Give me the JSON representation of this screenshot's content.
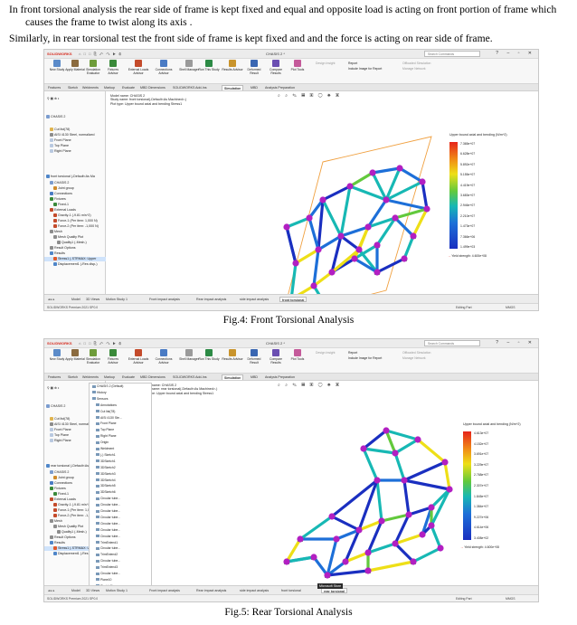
{
  "intro": {
    "line1": "In front torsional analysis the rear side of frame is kept fixed and equal and opposite load is acting on front portion of frame  which",
    "line2": "causes the frame to twist along its axis .",
    "line3": "Similarly, in rear torsional test the front side of frame is kept fixed and and the force is acting on rear side of frame."
  },
  "fig4": {
    "caption": "Fig.4: Front Torsional Analysis",
    "app": {
      "logo": "SOLIDWORKS",
      "document_title": "CHASIS 2 *",
      "search_placeholder": "Search Commands",
      "ribbon": [
        {
          "label": "New Study",
          "icon": "new-study-icon",
          "color": "#5b8bc9"
        },
        {
          "label": "Apply Material",
          "icon": "apply-material-icon",
          "color": "#8b6b3f"
        },
        {
          "label": "Simulation Evaluator",
          "icon": "simulation-evaluator-icon",
          "color": "#6e9c3a"
        },
        {
          "label": "Fixtures Advisor",
          "icon": "fixtures-advisor-icon",
          "color": "#3a8a3a"
        },
        {
          "label": "External Loads Advisor",
          "icon": "external-loads-icon",
          "color": "#c44b2b"
        },
        {
          "label": "Connections Advisor",
          "icon": "connections-advisor-icon",
          "color": "#4a7bc4"
        },
        {
          "label": "Shell Manager",
          "icon": "shell-manager-icon",
          "color": "#9a9a9a"
        },
        {
          "label": "Run This Study",
          "icon": "run-study-icon",
          "color": "#2c8a45"
        },
        {
          "label": "Results Advisor",
          "icon": "results-advisor-icon",
          "color": "#c9942c"
        },
        {
          "label": "Deformed Result",
          "icon": "deformed-result-icon",
          "color": "#3a67b2"
        },
        {
          "label": "Compare Results",
          "icon": "compare-results-icon",
          "color": "#6b4fb2"
        },
        {
          "label": "Plot Tools",
          "icon": "plot-tools-icon",
          "color": "#c45a9a"
        }
      ],
      "ribbon_right": {
        "design_insight": "Design Insight",
        "report": "Report",
        "include_image": "Include Image for Report",
        "offload": "Offloaded Simulation",
        "manage_network": "Manage Network"
      },
      "tabs": [
        "Features",
        "Sketch",
        "Weldments",
        "Markup",
        "Evaluate",
        "MBD Dimensions",
        "SOLIDWORKS Add-Ins",
        "Simulation",
        "MBD",
        "Analysis Preparation"
      ],
      "active_tab": "Simulation",
      "tree": [
        {
          "label": "CHASIS 2",
          "depth": 0,
          "color": "#7b9ccf"
        },
        {
          "label": "Cut list(78)",
          "depth": 1,
          "color": "#e0b44f"
        },
        {
          "label": "AISI 4130 Steel, normalized",
          "depth": 1,
          "color": "#8c8c8c"
        },
        {
          "label": "Front Plane",
          "depth": 1,
          "color": "#b9c9e0"
        },
        {
          "label": "Top Plane",
          "depth": 1,
          "color": "#b9c9e0"
        },
        {
          "label": "Right Plane",
          "depth": 1,
          "color": "#b9c9e0"
        },
        {
          "label": "front torsional (-Default<As Ma",
          "depth": 0,
          "color": "#4f86c9"
        },
        {
          "label": "CHASIS 2",
          "depth": 1,
          "color": "#7b9ccf"
        },
        {
          "label": "Joint group",
          "depth": 2,
          "color": "#d08b2b"
        },
        {
          "label": "Connections",
          "depth": 1,
          "color": "#4a7bc4"
        },
        {
          "label": "Fixtures",
          "depth": 1,
          "color": "#3a8a3a"
        },
        {
          "label": "Fixed-1",
          "depth": 2,
          "color": "#3a8a3a"
        },
        {
          "label": "External Loads",
          "depth": 1,
          "color": "#c44b2b"
        },
        {
          "label": "Gravity-1 (-9.81 m/s^2)",
          "depth": 2,
          "color": "#c44b2b"
        },
        {
          "label": "Force-1 (Per item: 1,000 N)",
          "depth": 2,
          "color": "#c44b2b"
        },
        {
          "label": "Force-2 (Per item: -1,000 N)",
          "depth": 2,
          "color": "#c44b2b"
        },
        {
          "label": "Mesh",
          "depth": 1,
          "color": "#8c8c8c"
        },
        {
          "label": "Mesh Quality Plot",
          "depth": 2,
          "color": "#8c8c8c"
        },
        {
          "label": "Quality1 (-Mesh-)",
          "depth": 3,
          "color": "#8c8c8c"
        },
        {
          "label": "Result Options",
          "depth": 1,
          "color": "#8c8c8c"
        },
        {
          "label": "Results",
          "depth": 1,
          "color": "#4f86c9"
        },
        {
          "label": "Stress1 (-STRMAX: Upper",
          "depth": 2,
          "color": "#e05a2b",
          "selected": true
        },
        {
          "label": "Displacement1 (-Res disp-)",
          "depth": 2,
          "color": "#4f86c9"
        }
      ],
      "viewport_info": [
        "Model name: CHASIS 2",
        "Study name: front torsional(-Default<As Machined>-)",
        "Plot type: Upper bound axial and bending Stress1"
      ],
      "legend": {
        "title": "Upper bound axial and bending (N/m^2)",
        "values": [
          "7.365e+07",
          "6.628e+07",
          "5.892e+07",
          "5.155e+07",
          "4.419e+07",
          "3.683e+07",
          "2.946e+07",
          "2.210e+07",
          "1.473e+07",
          "7.366e+06",
          "1.499e+03"
        ],
        "yield": "Yield strength: 4.600e+08"
      },
      "bottom_tabs": [
        "Model",
        "3D Views",
        "Motion Study 1",
        "Front impact analysis",
        "Rear impact analysis",
        "side impact analysis",
        "front torsional"
      ],
      "active_bottom_tab": "front torsional",
      "status_left": "SOLIDWORKS Premium 2021 SP0.0",
      "status_editing": "Editing Part",
      "status_units": "MMGS"
    }
  },
  "fig5": {
    "caption": "Fig.5: Rear Torsional Analysis",
    "app": {
      "logo": "SOLIDWORKS",
      "document_title": "CHASIS 2 *",
      "search_placeholder": "Search Commands",
      "tabs": [
        "Features",
        "Sketch",
        "Weldments",
        "Markup",
        "Evaluate",
        "MBD Dimensions",
        "SOLIDWORKS Add-Ins",
        "Simulation",
        "MBD",
        "Analysis Preparation"
      ],
      "active_tab": "Simulation",
      "tree": [
        {
          "label": "CHASIS 2",
          "depth": 0,
          "color": "#7b9ccf"
        },
        {
          "label": "Cut list(78)",
          "depth": 1,
          "color": "#e0b44f"
        },
        {
          "label": "AISI 4130 Steel, normalized",
          "depth": 1,
          "color": "#8c8c8c"
        },
        {
          "label": "Front Plane",
          "depth": 1,
          "color": "#b9c9e0"
        },
        {
          "label": "Top Plane",
          "depth": 1,
          "color": "#b9c9e0"
        },
        {
          "label": "Right Plane",
          "depth": 1,
          "color": "#b9c9e0"
        },
        {
          "label": "rear torsional (-Default<As Ma",
          "depth": 0,
          "color": "#4f86c9"
        },
        {
          "label": "CHASIS 2",
          "depth": 1,
          "color": "#7b9ccf"
        },
        {
          "label": "Joint group",
          "depth": 2,
          "color": "#d08b2b"
        },
        {
          "label": "Connections",
          "depth": 1,
          "color": "#4a7bc4"
        },
        {
          "label": "Fixtures",
          "depth": 1,
          "color": "#3a8a3a"
        },
        {
          "label": "Fixed-1",
          "depth": 2,
          "color": "#3a8a3a"
        },
        {
          "label": "External Loads",
          "depth": 1,
          "color": "#c44b2b"
        },
        {
          "label": "Gravity-1 (-9.81 m/s^2)",
          "depth": 2,
          "color": "#c44b2b"
        },
        {
          "label": "Force-1 (Per item: 1,000 N)",
          "depth": 2,
          "color": "#c44b2b"
        },
        {
          "label": "Force-2 (Per item: -1,000 N)",
          "depth": 2,
          "color": "#c44b2b"
        },
        {
          "label": "Mesh",
          "depth": 1,
          "color": "#8c8c8c"
        },
        {
          "label": "Mesh Quality Plot",
          "depth": 2,
          "color": "#8c8c8c"
        },
        {
          "label": "Quality1 (-Mesh-)",
          "depth": 3,
          "color": "#8c8c8c"
        },
        {
          "label": "Result Options",
          "depth": 1,
          "color": "#8c8c8c"
        },
        {
          "label": "Results",
          "depth": 1,
          "color": "#4f86c9"
        },
        {
          "label": "Stress1 (-STRMAX: Upper",
          "depth": 2,
          "color": "#e05a2b",
          "selected": true
        },
        {
          "label": "Displacement1 (-Res disp-)",
          "depth": 2,
          "color": "#4f86c9"
        }
      ],
      "viewport_info": [
        "Model name: CHASIS 2",
        "Study name: rear torsional(-Default<As Machined>-)",
        "Plot type: Upper bound axial and bending Stress1"
      ],
      "popup_items": [
        "CHASIS 2 (Default)",
        "History",
        "Sensors",
        "Annotations",
        "Cut list(78)",
        "AISI 4130 Ste...",
        "Front Plane",
        "Top Plane",
        "Right Plane",
        "Origin",
        "Weldment",
        "(-) Sketch1",
        "3DSketch1",
        "3DSketch2",
        "3DSketch3",
        "3DSketch4",
        "3DSketch5",
        "3DSketch6",
        "Circular tube...",
        "Circular tube...",
        "Circular tube...",
        "Circular tube...",
        "Circular tube...",
        "Circular tube...",
        "Circular tube...",
        "TrimExtend1",
        "Circular tube...",
        "TrimExtend2",
        "Circular tube...",
        "TrimExtend3",
        "Circular tube...",
        "Plane10",
        "Sketch11"
      ],
      "legend": {
        "title": "Upper bound axial and bending (N/m^2)",
        "values": [
          "4.613e+07",
          "4.152e+07",
          "3.691e+07",
          "3.229e+07",
          "2.768e+07",
          "2.307e+07",
          "1.845e+07",
          "1.384e+07",
          "9.227e+06",
          "4.614e+06",
          "3.408e+02"
        ],
        "yield": "Yield strength: 4.600e+08"
      },
      "bottom_tabs": [
        "Model",
        "3D Views",
        "Motion Study 1",
        "Front impact analysis",
        "Rear impact analysis",
        "side impact analysis",
        "front torsional",
        "rear torsional"
      ],
      "active_bottom_tab": "rear torsional",
      "tooltip": "Microsoft Store",
      "status_left": "SOLIDWORKS Premium 2021 SP0.0",
      "status_editing": "Editing Part",
      "status_units": "MMGS"
    }
  }
}
